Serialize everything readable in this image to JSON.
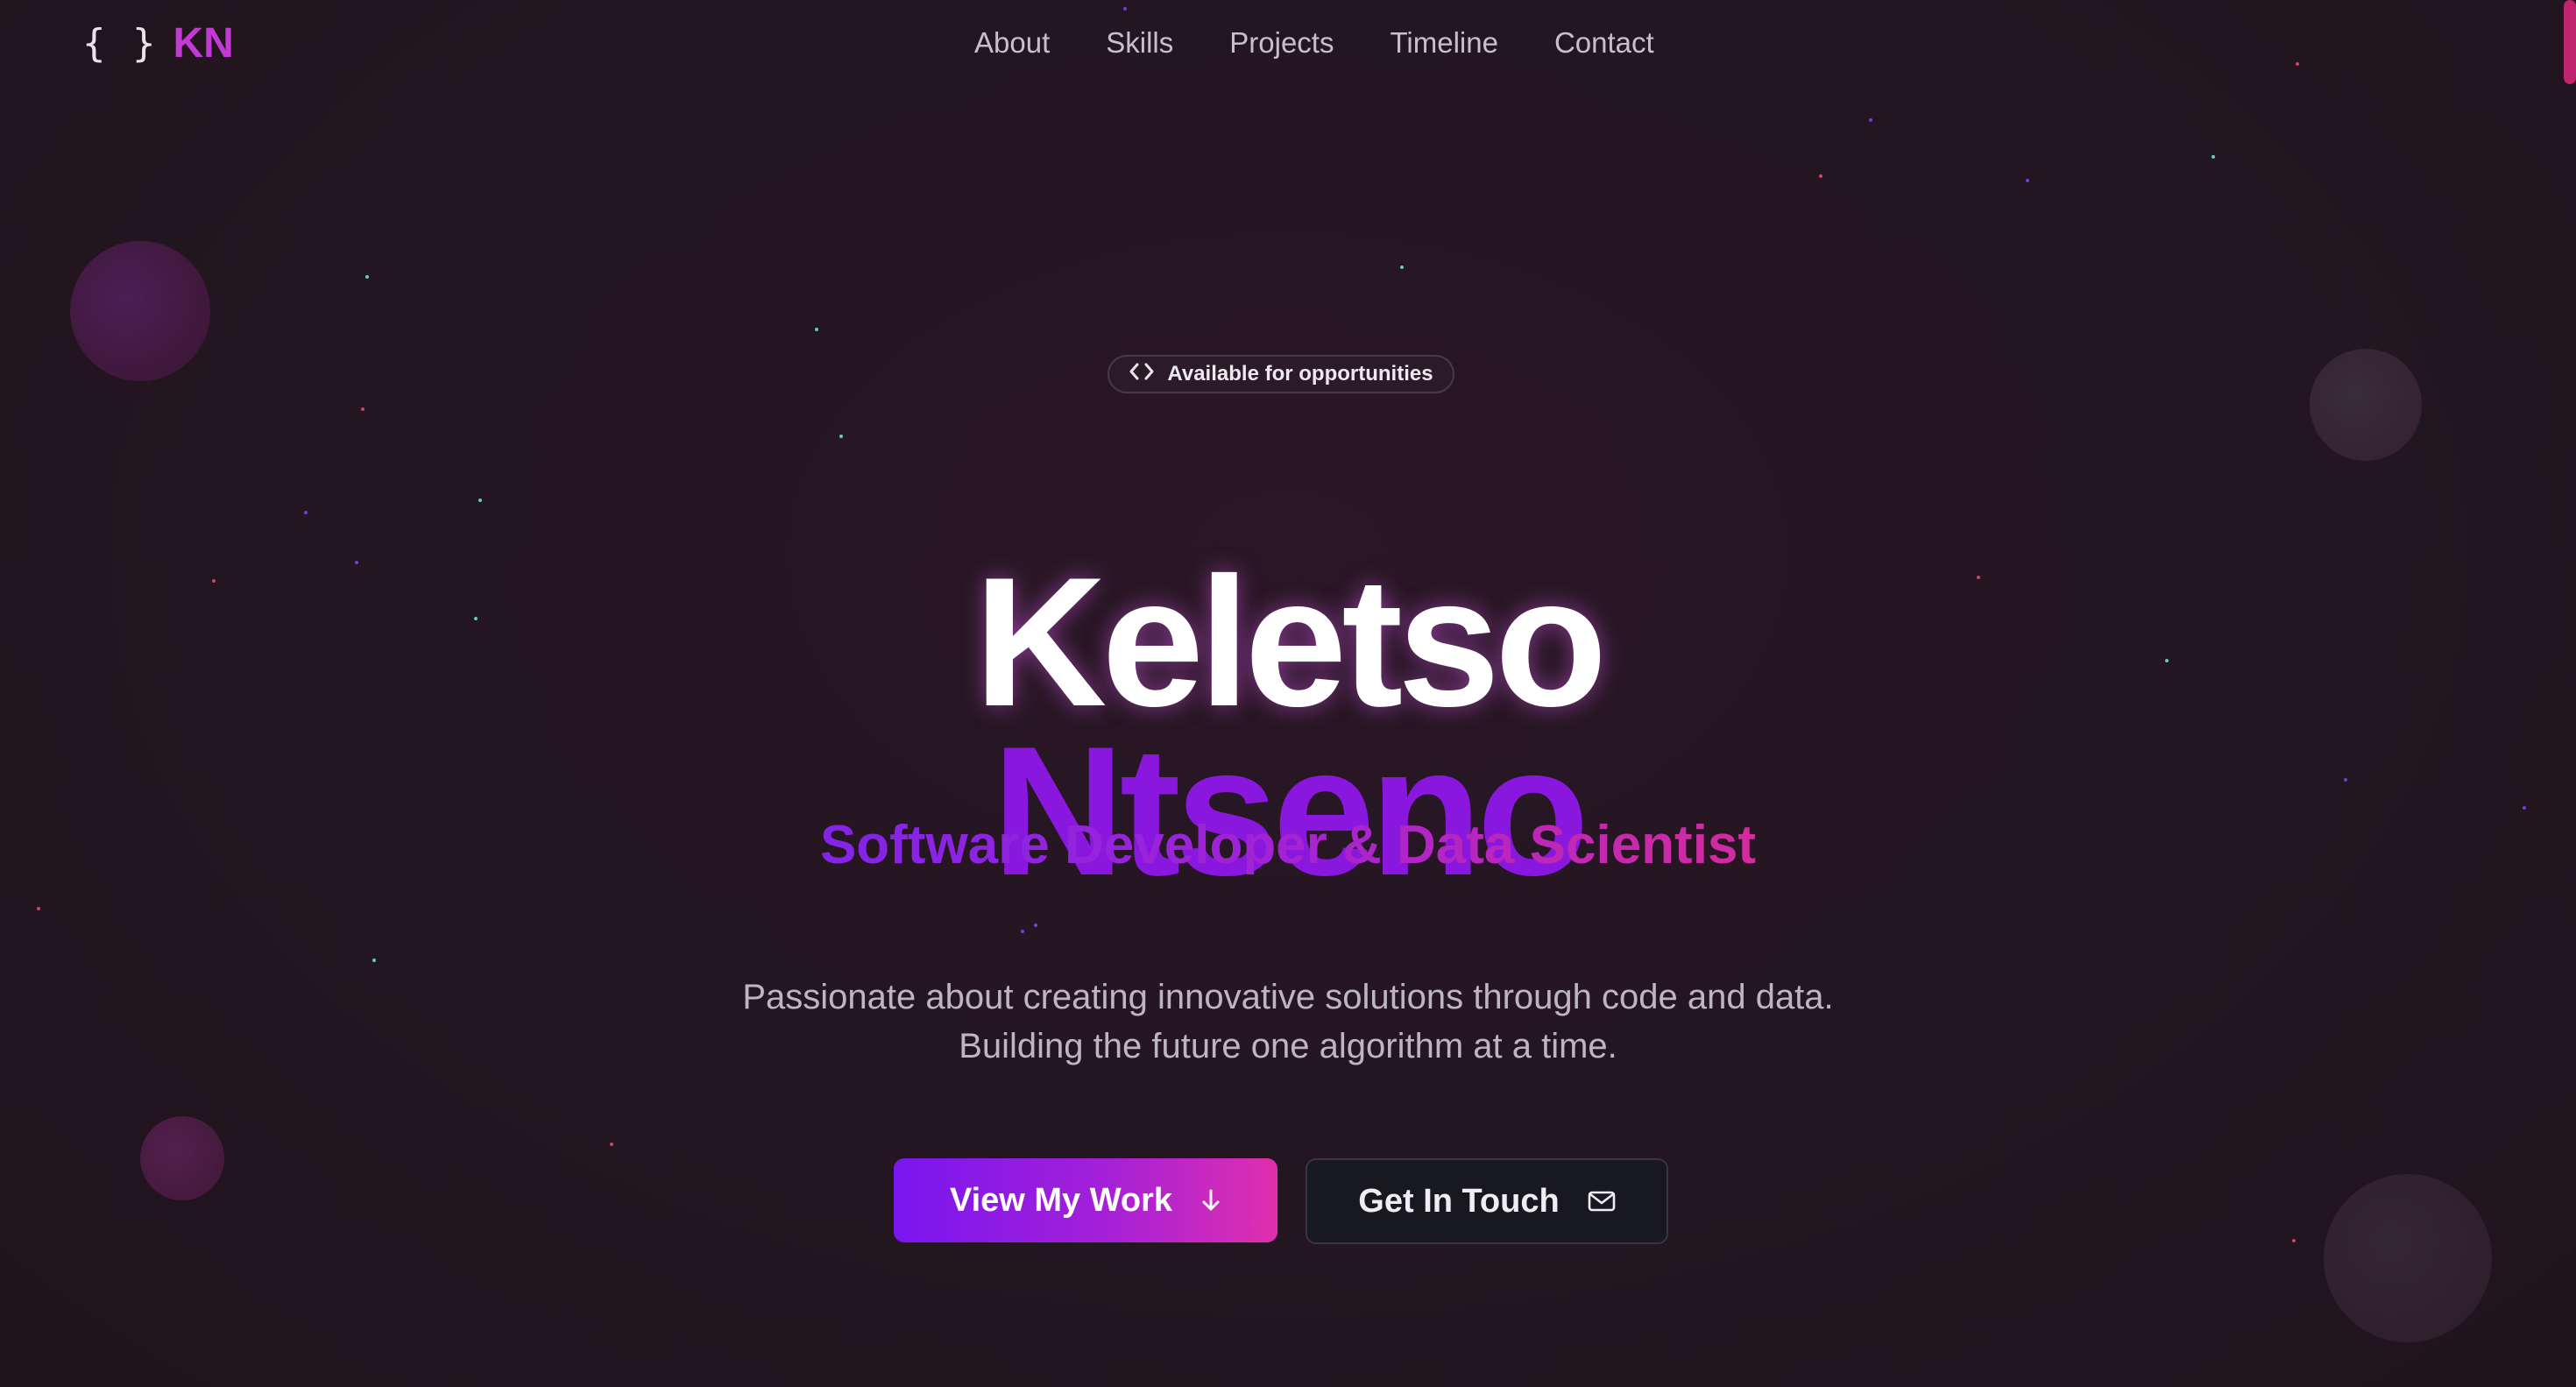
{
  "nav": {
    "logo_brace": "{ }",
    "logo_text": "KN",
    "links": [
      "About",
      "Skills",
      "Projects",
      "Timeline",
      "Contact"
    ]
  },
  "hero": {
    "badge_icon": "code-icon",
    "badge_text": "Available for opportunities",
    "first_name": "Keletso",
    "last_name": "Ntseno",
    "role": "Software Developer & Data Scientist",
    "description_line1": "Passionate about creating innovative solutions through code and data.",
    "description_line2": "Building the future one algorithm at a time.",
    "primary_button": "View My Work",
    "primary_button_icon": "arrow-down-icon",
    "secondary_button": "Get In Touch",
    "secondary_button_icon": "mail-icon"
  },
  "colors": {
    "background": "#231620",
    "accent_purple": "#8a17dd",
    "accent_pink": "#d42b9e",
    "logo": "#c03ad3"
  }
}
